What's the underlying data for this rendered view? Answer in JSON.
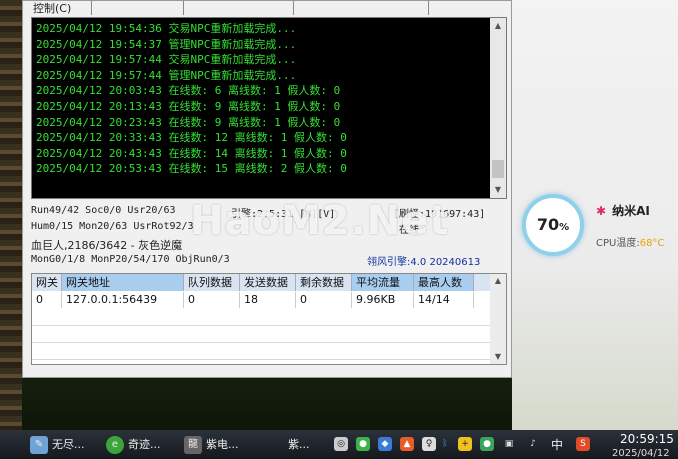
{
  "menu": {
    "control": "控制(C)"
  },
  "log": {
    "lines": [
      "2025/04/12 19:54:36 交易NPC重新加载完成...",
      "2025/04/12 19:54:37 管理NPC重新加载完成...",
      "2025/04/12 19:57:44 交易NPC重新加载完成...",
      "2025/04/12 19:57:44 管理NPC重新加载完成...",
      "2025/04/12 20:03:43 在线数: 6 离线数: 1 假人数: 0",
      "2025/04/12 20:13:43 在线数: 9 离线数: 1 假人数: 0",
      "2025/04/12 20:23:43 在线数: 9 离线数: 1 假人数: 0",
      "2025/04/12 20:33:43 在线数: 12 离线数: 1 假人数: 0",
      "2025/04/12 20:43:43 在线数: 14 离线数: 1 假人数: 0",
      "2025/04/12 20:53:43 在线数: 15 离线数: 2 假人数: 0"
    ]
  },
  "status": {
    "run": "Run49/42 Soc0/0 Usr20/63",
    "engine": "引擎:2:5:31 [M][V]",
    "monster": "[刷怪:101697:43]",
    "hum": "Hum0/15 Mon20/63 UsrRot92/3",
    "online_frag": "在线",
    "boss": "血巨人,2186/3642 - 灰色逆魔",
    "mon": "MonG0/1/8 MonP20/54/170 ObjRun0/3",
    "version": "翎风引擎:4.0 20240613"
  },
  "watermark": "HaoM2.Net",
  "gateway": {
    "headers": [
      "网关",
      "网关地址",
      "队列数据",
      "发送数据",
      "剩余数据",
      "平均流量",
      "最高人数"
    ],
    "rows": [
      [
        "0",
        "127.0.0.1:56439",
        "0",
        "18",
        "0",
        "9.96KB",
        "14/14"
      ]
    ]
  },
  "widget": {
    "percent": "70",
    "percent_sign": "%",
    "brand": "纳米AI",
    "cpu_label": "CPU温度:",
    "cpu_value": "68°C"
  },
  "taskbar": {
    "items": [
      "无尽...",
      "奇迹...",
      "紫电...",
      "紫..."
    ],
    "tray_lang": "中",
    "time": "20:59:15",
    "date": "2025/04/12"
  }
}
